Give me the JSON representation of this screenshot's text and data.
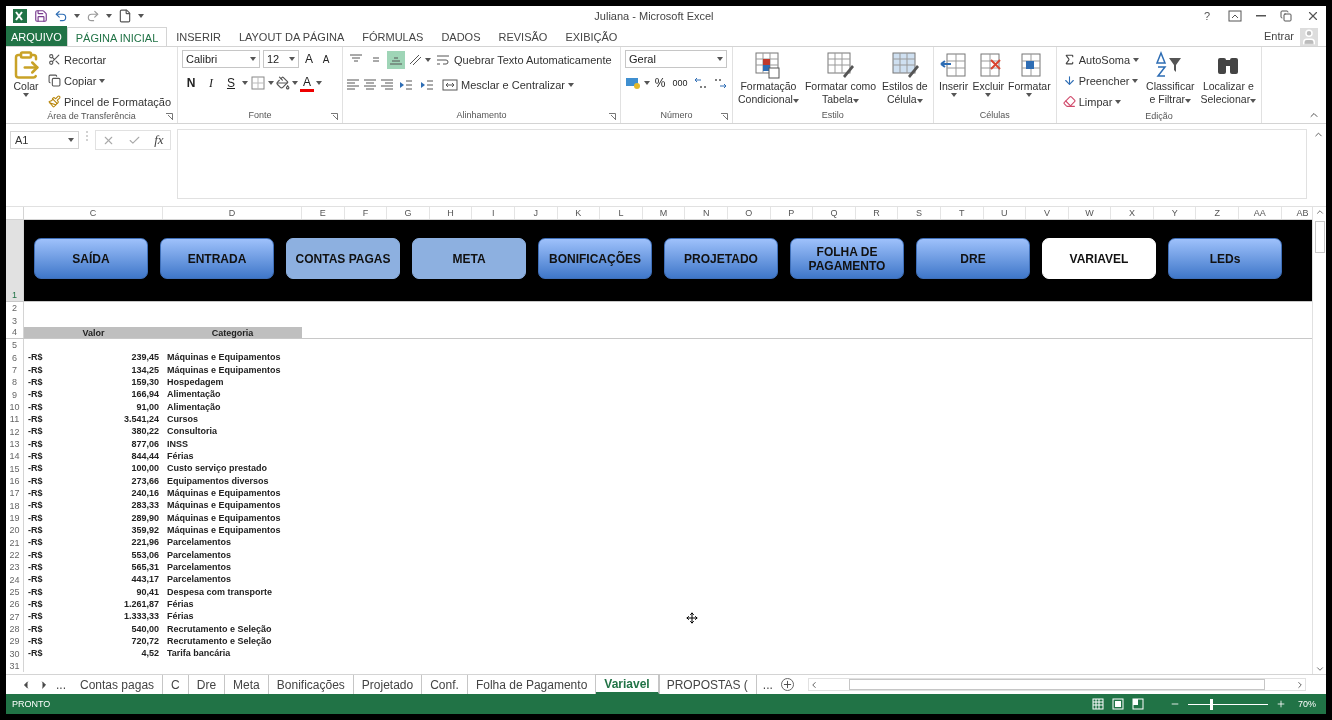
{
  "window": {
    "title": "Juliana - Microsoft Excel",
    "help": "?"
  },
  "ribbon_tabs": [
    {
      "label": "ARQUIVO",
      "kind": "file",
      "selected": false
    },
    {
      "label": "PÁGINA INICIAL",
      "kind": "tab",
      "selected": true
    },
    {
      "label": "INSERIR",
      "kind": "tab",
      "selected": false
    },
    {
      "label": "LAYOUT DA PÁGINA",
      "kind": "tab",
      "selected": false
    },
    {
      "label": "FÓRMULAS",
      "kind": "tab",
      "selected": false
    },
    {
      "label": "DADOS",
      "kind": "tab",
      "selected": false
    },
    {
      "label": "REVISÃO",
      "kind": "tab",
      "selected": false
    },
    {
      "label": "EXIBIÇÃO",
      "kind": "tab",
      "selected": false
    }
  ],
  "account": "Entrar",
  "ribbon_groups": [
    {
      "kind": "clipboard",
      "title": "Área de Transferência",
      "launcher": true,
      "paste": "Colar",
      "commands": [
        {
          "label": "Recortar",
          "dropdown": false
        },
        {
          "label": "Copiar",
          "dropdown": true
        },
        {
          "label": "Pincel de Formatação",
          "dropdown": false
        }
      ]
    },
    {
      "kind": "font",
      "title": "Fonte",
      "launcher": true,
      "font_name": "Calibri",
      "font_size": "12",
      "grow": "A",
      "shrink": "A",
      "bold": "N",
      "italic": "I",
      "underline": "S",
      "font_color": "A"
    },
    {
      "kind": "alignment",
      "title": "Alinhamento",
      "launcher": true,
      "vertical_align": [
        {
          "selected": false
        },
        {
          "selected": false
        },
        {
          "selected": true
        }
      ],
      "wrap": "Quebrar Texto Automaticamente",
      "merge": "Mesclar e Centralizar"
    },
    {
      "kind": "number",
      "title": "Número",
      "launcher": true,
      "format": "Geral",
      "percent": "%",
      "thousands": "000"
    },
    {
      "kind": "styles",
      "title": "Estilo",
      "launcher": false,
      "buttons": [
        {
          "lines": [
            "Formatação",
            "Condicional"
          ]
        },
        {
          "lines": [
            "Formatar como",
            "Tabela"
          ]
        },
        {
          "lines": [
            "Estilos de",
            "Célula"
          ]
        }
      ]
    },
    {
      "kind": "cells",
      "title": "Células",
      "launcher": false,
      "buttons": [
        {
          "lines": [
            "Inserir"
          ]
        },
        {
          "lines": [
            "Excluir"
          ]
        },
        {
          "lines": [
            "Formatar"
          ]
        }
      ]
    },
    {
      "kind": "editing",
      "title": "Edição",
      "launcher": false,
      "commands": [
        {
          "label": "AutoSoma"
        },
        {
          "label": "Preencher"
        },
        {
          "label": "Limpar"
        }
      ],
      "buttons": [
        {
          "lines": [
            "Classificar",
            "e Filtrar"
          ]
        },
        {
          "lines": [
            "Localizar e",
            "Selecionar"
          ]
        }
      ]
    }
  ],
  "formula_bar": {
    "name_box": "A1",
    "function_label": "fx"
  },
  "columns": [
    "C",
    "D",
    "E",
    "F",
    "G",
    "H",
    "I",
    "J",
    "K",
    "L",
    "M",
    "N",
    "O",
    "P",
    "Q",
    "R",
    "S",
    "T",
    "U",
    "V",
    "W",
    "X",
    "Y",
    "Z",
    "AA",
    "AB"
  ],
  "band": {
    "row_number": "1",
    "buttons": [
      {
        "label": "SAÍDA",
        "kind": "gradient",
        "selected": false
      },
      {
        "label": "ENTRADA",
        "kind": "gradient",
        "selected": false
      },
      {
        "label": "CONTAS PAGAS",
        "kind": "flat",
        "selected": false
      },
      {
        "label": "META",
        "kind": "flat",
        "selected": false
      },
      {
        "label": "BONIFICAÇÕES",
        "kind": "gradient",
        "selected": false
      },
      {
        "label": "PROJETADO",
        "kind": "gradient",
        "selected": false
      },
      {
        "label": "FOLHA DE PAGAMENTO",
        "kind": "gradient",
        "selected": false
      },
      {
        "label": "DRE",
        "kind": "gradient",
        "selected": false
      },
      {
        "label": "VARIAVEL",
        "kind": "gradient",
        "selected": true
      },
      {
        "label": "LEDs",
        "kind": "gradient",
        "selected": false
      }
    ]
  },
  "rows": [
    {
      "number": "2",
      "kind": "blank"
    },
    {
      "number": "3",
      "kind": "blank"
    },
    {
      "number": "4",
      "kind": "header",
      "value": "Valor",
      "category": "Categoria"
    },
    {
      "number": "5",
      "kind": "blank"
    },
    {
      "number": "6",
      "kind": "entry",
      "currency": "-R$",
      "value": "239,45",
      "category": "Máquinas e Equipamentos"
    },
    {
      "number": "7",
      "kind": "entry",
      "currency": "-R$",
      "value": "134,25",
      "category": "Máquinas e Equipamentos"
    },
    {
      "number": "8",
      "kind": "entry",
      "currency": "-R$",
      "value": "159,30",
      "category": "Hospedagem"
    },
    {
      "number": "9",
      "kind": "entry",
      "currency": "-R$",
      "value": "166,94",
      "category": "Alimentação"
    },
    {
      "number": "10",
      "kind": "entry",
      "currency": "-R$",
      "value": "91,00",
      "category": "Alimentação"
    },
    {
      "number": "11",
      "kind": "entry",
      "currency": "-R$",
      "value": "3.541,24",
      "category": "Cursos"
    },
    {
      "number": "12",
      "kind": "entry",
      "currency": "-R$",
      "value": "380,22",
      "category": "Consultoria"
    },
    {
      "number": "13",
      "kind": "entry",
      "currency": "-R$",
      "value": "877,06",
      "category": "INSS"
    },
    {
      "number": "14",
      "kind": "entry",
      "currency": "-R$",
      "value": "844,44",
      "category": "Férias"
    },
    {
      "number": "15",
      "kind": "entry",
      "currency": "-R$",
      "value": "100,00",
      "category": "Custo serviço prestado"
    },
    {
      "number": "16",
      "kind": "entry",
      "currency": "-R$",
      "value": "273,66",
      "category": "Equipamentos diversos"
    },
    {
      "number": "17",
      "kind": "entry",
      "currency": "-R$",
      "value": "240,16",
      "category": "Máquinas e Equipamentos"
    },
    {
      "number": "18",
      "kind": "entry",
      "currency": "-R$",
      "value": "283,33",
      "category": "Máquinas e Equipamentos"
    },
    {
      "number": "19",
      "kind": "entry",
      "currency": "-R$",
      "value": "289,90",
      "category": "Máquinas e Equipamentos"
    },
    {
      "number": "20",
      "kind": "entry",
      "currency": "-R$",
      "value": "359,92",
      "category": "Máquinas e Equipamentos"
    },
    {
      "number": "21",
      "kind": "entry",
      "currency": "-R$",
      "value": "221,96",
      "category": "Parcelamentos"
    },
    {
      "number": "22",
      "kind": "entry",
      "currency": "-R$",
      "value": "553,06",
      "category": "Parcelamentos"
    },
    {
      "number": "23",
      "kind": "entry",
      "currency": "-R$",
      "value": "565,31",
      "category": "Parcelamentos"
    },
    {
      "number": "24",
      "kind": "entry",
      "currency": "-R$",
      "value": "443,17",
      "category": "Parcelamentos"
    },
    {
      "number": "25",
      "kind": "entry",
      "currency": "-R$",
      "value": "90,41",
      "category": "Despesa com transporte"
    },
    {
      "number": "26",
      "kind": "entry",
      "currency": "-R$",
      "value": "1.261,87",
      "category": "Férias"
    },
    {
      "number": "27",
      "kind": "entry",
      "currency": "-R$",
      "value": "1.333,33",
      "category": "Férias"
    },
    {
      "number": "28",
      "kind": "entry",
      "currency": "-R$",
      "value": "540,00",
      "category": "Recrutamento e Seleção"
    },
    {
      "number": "29",
      "kind": "entry",
      "currency": "-R$",
      "value": "720,72",
      "category": "Recrutamento e Seleção"
    },
    {
      "number": "30",
      "kind": "entry",
      "currency": "-R$",
      "value": "4,52",
      "category": "Tarifa bancária"
    },
    {
      "number": "31",
      "kind": "blank"
    }
  ],
  "sheet_tabs": {
    "overflow_before": "...",
    "tabs": [
      {
        "label": "Contas pagas",
        "selected": false
      },
      {
        "label": "C",
        "selected": false
      },
      {
        "label": "Dre",
        "selected": false
      },
      {
        "label": "Meta",
        "selected": false
      },
      {
        "label": "Bonificações",
        "selected": false
      },
      {
        "label": "Projetado",
        "selected": false
      },
      {
        "label": "Conf.",
        "selected": false
      },
      {
        "label": "Folha de Pagamento",
        "selected": false
      },
      {
        "label": "Variavel",
        "selected": true
      },
      {
        "label": "PROPOSTAS (",
        "selected": false
      }
    ],
    "overflow_after": "..."
  },
  "status_bar": {
    "status": "PRONTO",
    "zoom": "70%",
    "zoom_slider": {
      "level": 0.28
    }
  }
}
